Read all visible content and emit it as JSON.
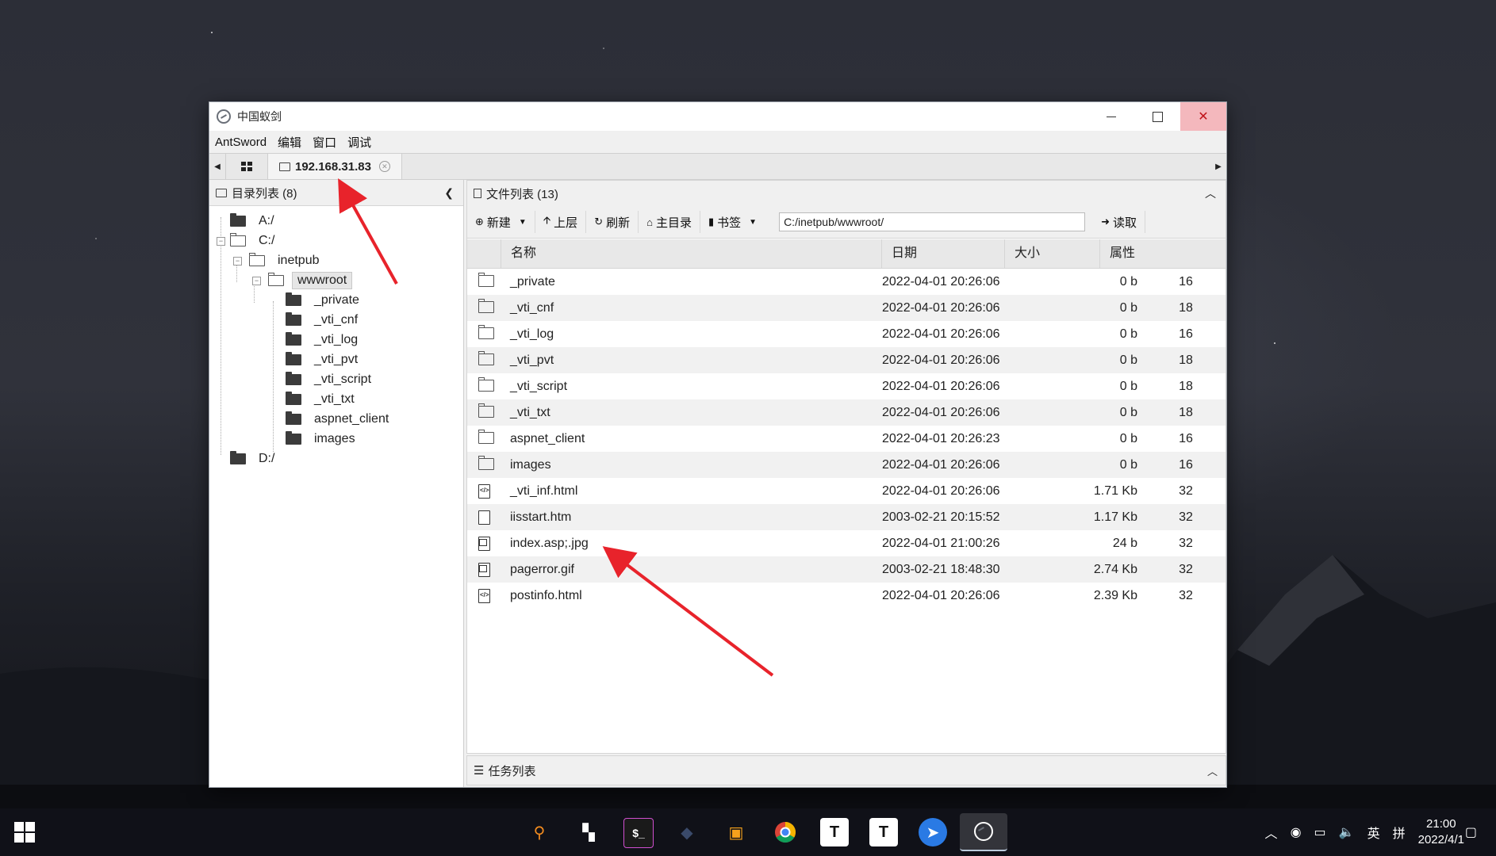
{
  "window": {
    "title": "中国蚁剑",
    "menu": [
      "AntSword",
      "编辑",
      "窗口",
      "调试"
    ],
    "tab_ip": "192.168.31.83"
  },
  "left_panel": {
    "title": "目录列表 (8)",
    "tree": [
      "A:/",
      "C:/",
      "inetpub",
      "wwwroot",
      "_private",
      "_vti_cnf",
      "_vti_log",
      "_vti_pvt",
      "_vti_script",
      "_vti_txt",
      "aspnet_client",
      "images",
      "D:/"
    ]
  },
  "right_panel": {
    "title": "文件列表 (13)",
    "toolbar": {
      "new": "新建",
      "up": "上层",
      "refresh": "刷新",
      "home": "主目录",
      "bookmark": "书签",
      "path": "C:/inetpub/wwwroot/",
      "read": "读取"
    },
    "columns": [
      "名称",
      "日期",
      "大小",
      "属性"
    ],
    "files": [
      {
        "icon": "folder",
        "name": "_private",
        "date": "2022-04-01 20:26:06",
        "size": "0 b",
        "attr": "16"
      },
      {
        "icon": "folder",
        "name": "_vti_cnf",
        "date": "2022-04-01 20:26:06",
        "size": "0 b",
        "attr": "18"
      },
      {
        "icon": "folder",
        "name": "_vti_log",
        "date": "2022-04-01 20:26:06",
        "size": "0 b",
        "attr": "16"
      },
      {
        "icon": "folder",
        "name": "_vti_pvt",
        "date": "2022-04-01 20:26:06",
        "size": "0 b",
        "attr": "18"
      },
      {
        "icon": "folder",
        "name": "_vti_script",
        "date": "2022-04-01 20:26:06",
        "size": "0 b",
        "attr": "18"
      },
      {
        "icon": "folder",
        "name": "_vti_txt",
        "date": "2022-04-01 20:26:06",
        "size": "0 b",
        "attr": "18"
      },
      {
        "icon": "folder",
        "name": "aspnet_client",
        "date": "2022-04-01 20:26:23",
        "size": "0 b",
        "attr": "16"
      },
      {
        "icon": "folder",
        "name": "images",
        "date": "2022-04-01 20:26:06",
        "size": "0 b",
        "attr": "16"
      },
      {
        "icon": "code-file",
        "name": "_vti_inf.html",
        "date": "2022-04-01 20:26:06",
        "size": "1.71 Kb",
        "attr": "32"
      },
      {
        "icon": "file",
        "name": "iisstart.htm",
        "date": "2003-02-21 20:15:52",
        "size": "1.17 Kb",
        "attr": "32"
      },
      {
        "icon": "image-file",
        "name": "index.asp;.jpg",
        "date": "2022-04-01 21:00:26",
        "size": "24 b",
        "attr": "32"
      },
      {
        "icon": "image-file",
        "name": "pagerror.gif",
        "date": "2003-02-21 18:48:30",
        "size": "2.74 Kb",
        "attr": "32"
      },
      {
        "icon": "code-file",
        "name": "postinfo.html",
        "date": "2022-04-01 20:26:06",
        "size": "2.39 Kb",
        "attr": "32"
      }
    ],
    "task_title": "任务列表"
  },
  "taskbar": {
    "apps": [
      "search-app",
      "app-2",
      "terminal-app",
      "app-4",
      "app-5",
      "chrome-app",
      "typora-app-1",
      "typora-app-2",
      "feishu-app",
      "antsword-app"
    ],
    "ime": "英",
    "ime2": "拼",
    "time": "21:00",
    "date": "2022/4/1"
  },
  "colors": {
    "arrow": "#e8232b",
    "close_hover": "#f4b8bd"
  }
}
